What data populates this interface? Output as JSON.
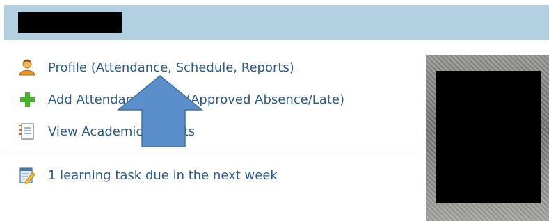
{
  "links": [
    {
      "label": "Profile (Attendance, Schedule, Reports)",
      "icon": "user-icon"
    },
    {
      "label": "Add Attendance Note (Approved Absence/Late)",
      "icon": "plus-icon"
    },
    {
      "label": "View Academic Reports",
      "icon": "report-icon"
    }
  ],
  "task": {
    "label": "1 learning task due in the next week",
    "icon": "task-icon"
  },
  "colors": {
    "header_bar": "#b3cfe2",
    "link_text": "#2d5a8a",
    "arrow": "#5b8fcb",
    "redaction": "#000000"
  }
}
